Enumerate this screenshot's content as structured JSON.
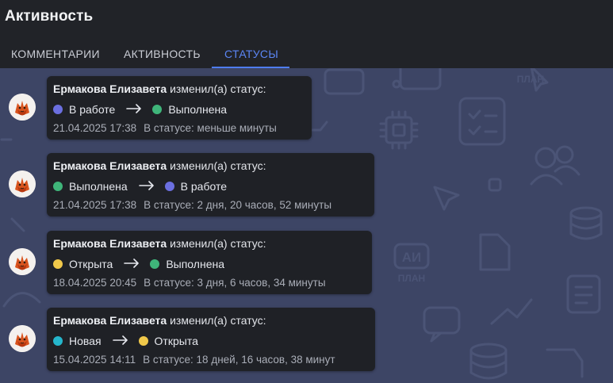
{
  "header": {
    "title": "Активность"
  },
  "tabs": [
    {
      "label": "КОММЕНТАРИИ"
    },
    {
      "label": "АКТИВНОСТЬ"
    },
    {
      "label": "СТАТУСЫ"
    }
  ],
  "active_tab": "СТАТУСЫ",
  "background_logo": {
    "text_top": "АИ",
    "text_bottom": "ПЛАН"
  },
  "status_colors": {
    "В работе": "#6b6fe0",
    "Выполнена": "#3fb57a",
    "Открыта": "#f0c84a",
    "Новая": "#25b6cc"
  },
  "entries": [
    {
      "author": "Ермакова Елизавета",
      "action": "изменил(а) статус:",
      "from_status": "В работе",
      "from_color": "#6b6fe0",
      "to_status": "Выполнена",
      "to_color": "#3fb57a",
      "timestamp": "21.04.2025 17:38",
      "duration": "В статусе: меньше минуты"
    },
    {
      "author": "Ермакова Елизавета",
      "action": "изменил(а) статус:",
      "from_status": "Выполнена",
      "from_color": "#3fb57a",
      "to_status": "В работе",
      "to_color": "#6b6fe0",
      "timestamp": "21.04.2025 17:38",
      "duration": "В статусе: 2 дня, 20 часов, 52 минуты"
    },
    {
      "author": "Ермакова Елизавета",
      "action": "изменил(а) статус:",
      "from_status": "Открыта",
      "from_color": "#f0c84a",
      "to_status": "Выполнена",
      "to_color": "#3fb57a",
      "timestamp": "18.04.2025 20:45",
      "duration": "В статусе: 3 дня, 6 часов, 34 минуты"
    },
    {
      "author": "Ермакова Елизавета",
      "action": "изменил(а) статус:",
      "from_status": "Новая",
      "from_color": "#25b6cc",
      "to_status": "Открыта",
      "to_color": "#f0c84a",
      "timestamp": "15.04.2025 14:11",
      "duration": "В статусе: 18 дней, 16 часов, 38 минут"
    }
  ]
}
